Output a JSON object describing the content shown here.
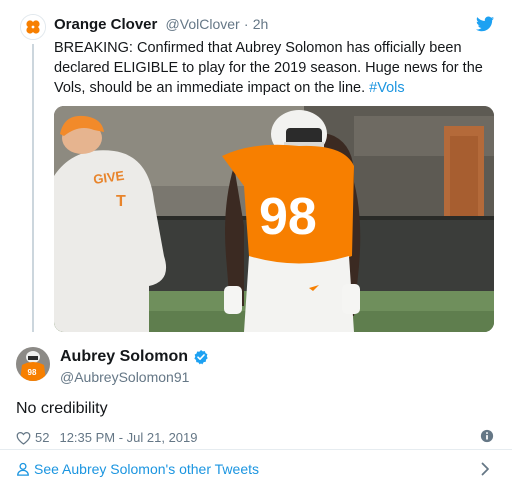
{
  "quoted_tweet": {
    "author_name": "Orange Clover",
    "author_handle": "@VolClover",
    "separator": "·",
    "time": "2h",
    "text_main": "BREAKING: Confirmed that Aubrey Solomon has officially been declared ELIGIBLE to play for the 2019 season. Huge news for the Vols, should be an immediate impact on the line.",
    "hashtag": "#Vols",
    "media": {
      "jersey_number": "98",
      "hoodie_text": "GIVE",
      "hoodie_logo": "T"
    }
  },
  "tweet": {
    "author_name": "Aubrey Solomon",
    "author_handle": "@AubreySolomon91",
    "text": "No credibility",
    "likes": "52",
    "timestamp": "12:35 PM - Jul 21, 2019"
  },
  "footer": {
    "see_more_label": "See Aubrey Solomon's other Tweets"
  },
  "colors": {
    "link": "#1b95e0",
    "secondary_text": "#657786",
    "brand_orange": "#f77f00",
    "verified_blue": "#1da1f2"
  },
  "icons": [
    "clover-icon",
    "twitter-bird-icon",
    "verified-badge-icon",
    "heart-icon",
    "info-icon",
    "person-icon",
    "chevron-right-icon"
  ]
}
